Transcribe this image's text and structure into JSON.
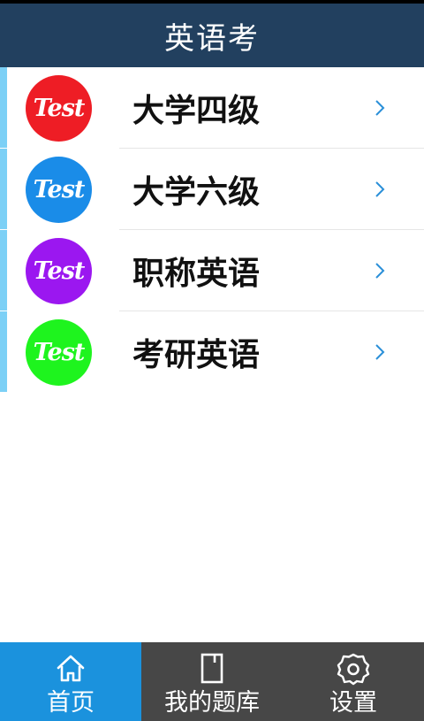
{
  "header": {
    "title": "英语考"
  },
  "exam_list": {
    "items": [
      {
        "label": "大学四级",
        "badge_text": "Test",
        "badge_color": "#ee1d25",
        "icon": "chevron-right-icon"
      },
      {
        "label": "大学六级",
        "badge_text": "Test",
        "badge_color": "#1a8ce8",
        "icon": "chevron-right-icon"
      },
      {
        "label": "职称英语",
        "badge_text": "Test",
        "badge_color": "#9b17f0",
        "icon": "chevron-right-icon"
      },
      {
        "label": "考研英语",
        "badge_text": "Test",
        "badge_color": "#1ef41e",
        "icon": "chevron-right-icon"
      }
    ]
  },
  "tabbar": {
    "tabs": [
      {
        "label": "首页",
        "icon": "home-icon",
        "active": true
      },
      {
        "label": "我的题库",
        "icon": "book-icon",
        "active": false
      },
      {
        "label": "设置",
        "icon": "gear-icon",
        "active": false
      }
    ]
  },
  "colors": {
    "header_bg": "#22405f",
    "accent_bar": "#7cd0f6",
    "chevron": "#2a8fd8",
    "tabbar_bg": "#474747",
    "tab_active_bg": "#1b92dd"
  }
}
